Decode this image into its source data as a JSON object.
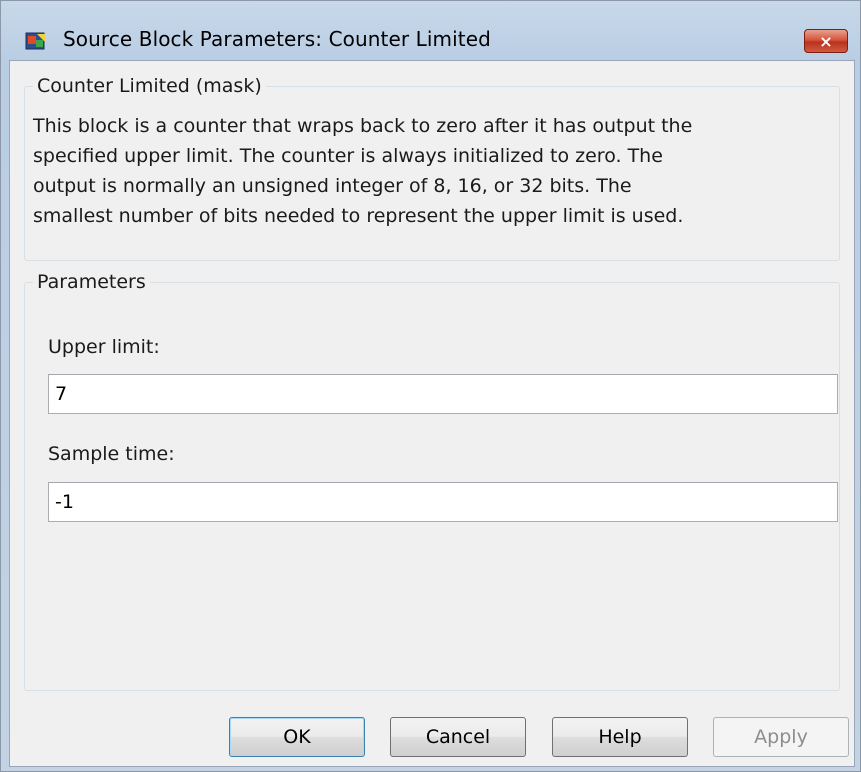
{
  "window": {
    "title": "Source Block Parameters: Counter Limited",
    "close_label": "×"
  },
  "mask": {
    "group_title": "Counter Limited (mask)",
    "description_lines": [
      "This block is a counter that wraps back to zero after it has output the",
      "specified upper limit.  The counter is always initialized to zero.  The",
      "output is normally an unsigned integer of 8, 16, or 32 bits.  The",
      "smallest number of bits needed to represent the upper limit is used."
    ]
  },
  "parameters": {
    "group_title": "Parameters",
    "upper_limit_label": "Upper limit:",
    "upper_limit_value": "7",
    "sample_time_label": "Sample time:",
    "sample_time_value": "-1"
  },
  "buttons": {
    "ok": "OK",
    "cancel": "Cancel",
    "help": "Help",
    "apply": "Apply"
  },
  "icons": {
    "app": "simulink-block-icon",
    "close": "close-icon"
  }
}
